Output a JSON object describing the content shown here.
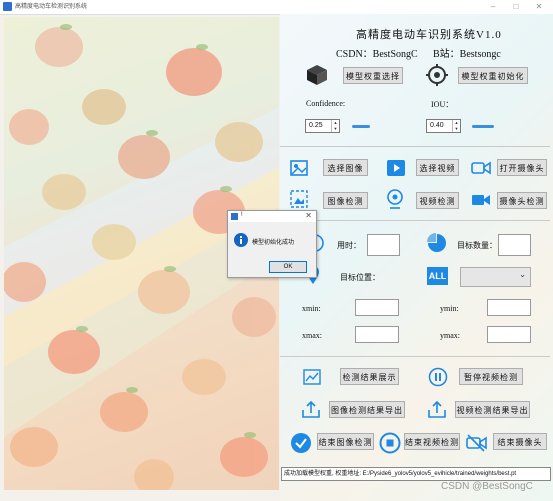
{
  "window": {
    "title": "高精度电动车检测识别系统"
  },
  "header": {
    "title": "高精度电动车识别系统V1.0",
    "csdn": "CSDN：BestSongC",
    "bili": "B站：Bestsongc"
  },
  "model": {
    "select_label": "模型权重选择",
    "init_label": "模型权重初始化"
  },
  "params": {
    "confidence_label": "Confidence:",
    "confidence_value": "0.25",
    "iou_label": "IOU：",
    "iou_value": "0.40"
  },
  "sources": {
    "image_label": "选择图像",
    "video_label": "选择视频",
    "camera_label": "打开摄像头"
  },
  "detect": {
    "image_label": "图像检测",
    "video_label": "视频检测",
    "camera_label": "摄像头检测"
  },
  "info": {
    "time_label": "用时：",
    "time_value": "",
    "count_label": "目标数量：",
    "count_value": "",
    "position_label": "目标位置：",
    "all_badge": "ALL",
    "target_select_value": "",
    "xmin_label": "xmin:",
    "ymin_label": "ymin:",
    "xmax_label": "xmax:",
    "ymax_label": "ymax:"
  },
  "results": {
    "show_label": "检测结果展示",
    "pause_label": "暂停视频检测",
    "export_image_label": "图像检测结果导出",
    "export_video_label": "视频检测结果导出",
    "end_image_label": "结束图像检测",
    "end_video_label": "结束视频检测",
    "end_camera_label": "结束摄像头"
  },
  "dialog": {
    "title": "!",
    "message": "模型初始化成功",
    "ok_label": "OK"
  },
  "status": {
    "text": "成功加载模型权重, 权重地址: E:/Pyside6_yolov5/yolov5_evihicle/trained/weights/best.pt"
  },
  "watermark": "CSDN @BestSongC",
  "colors": {
    "accent": "#1e88e5",
    "slider": "#3b8fe0"
  }
}
